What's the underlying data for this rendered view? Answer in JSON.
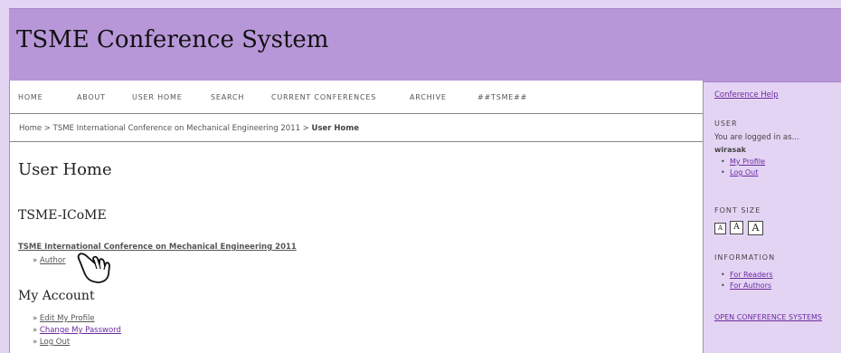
{
  "header": {
    "title": "TSME Conference System"
  },
  "nav": [
    "HOME",
    "ABOUT",
    "USER HOME",
    "SEARCH",
    "CURRENT CONFERENCES",
    "ARCHIVE",
    "##TSME##"
  ],
  "breadcrumb": {
    "home": "Home",
    "sep1": ">",
    "conference": "TSME International Conference on Mechanical Engineering 2011",
    "sep2": ">",
    "current": "User Home"
  },
  "main": {
    "title": "User Home",
    "conference_heading": "TSME-ICoME",
    "conference_link": "TSME International Conference on Mechanical Engineering 2011",
    "role_prefix": "»",
    "role_link": "Author",
    "account_heading": "My Account",
    "account_links": [
      {
        "prefix": "»",
        "label": "Edit My Profile"
      },
      {
        "prefix": "»",
        "label": "Change My Password"
      },
      {
        "prefix": "»",
        "label": "Log Out"
      }
    ]
  },
  "sidebar": {
    "help_link": "Conference Help",
    "user_heading": "USER",
    "logged_in_text": "You are logged in as...",
    "username": "wirasak",
    "user_links": [
      "My Profile",
      "Log Out"
    ],
    "font_size_heading": "FONT SIZE",
    "font_size_options": [
      "A",
      "A",
      "A"
    ],
    "information_heading": "INFORMATION",
    "information_links": [
      "For Readers",
      "For Authors"
    ],
    "ocs_link": "OPEN CONFERENCE SYSTEMS"
  },
  "colors": {
    "header_bg": "#b897d9",
    "page_bg": "#e4d4f4",
    "link_visited": "#6a2aa0"
  },
  "cursor": {
    "icon": "hand-pointer-icon"
  }
}
